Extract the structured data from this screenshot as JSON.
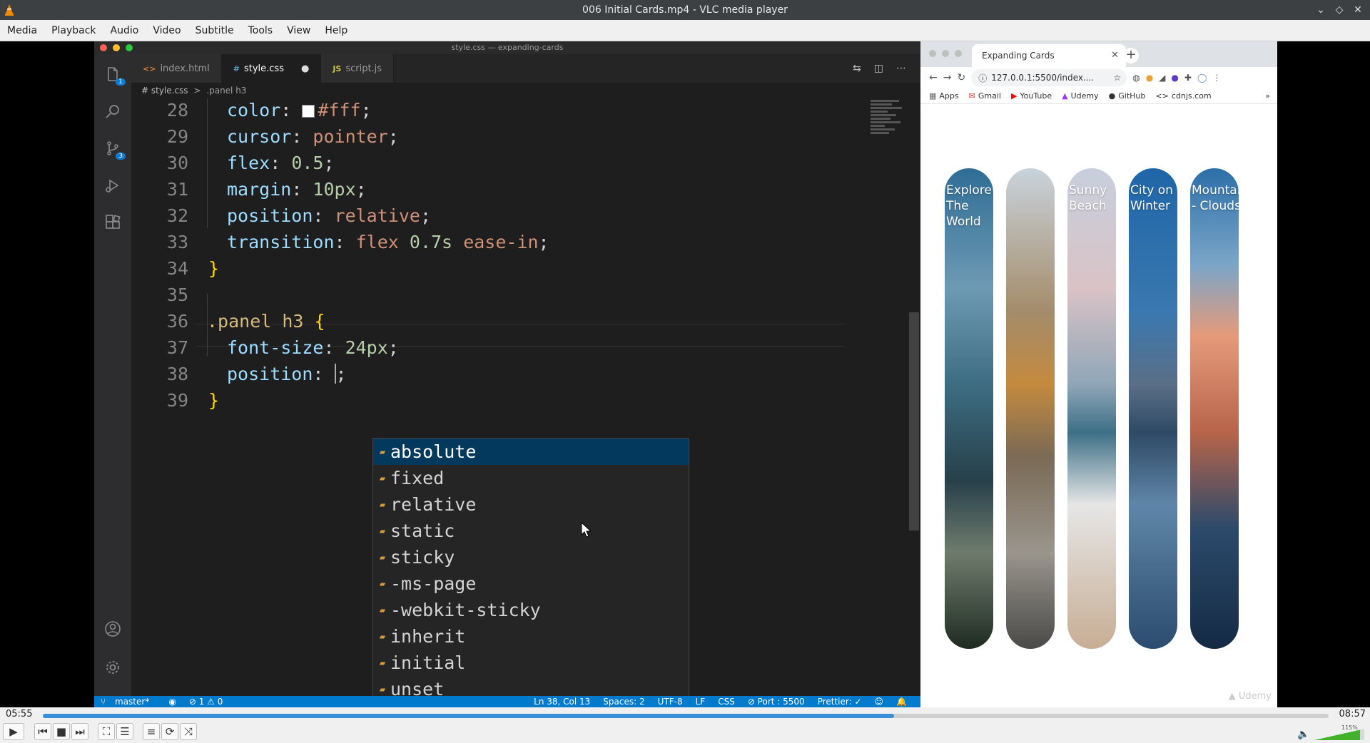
{
  "window": {
    "title": "006 Initial Cards.mp4 - VLC media player"
  },
  "menu": [
    "Media",
    "Playback",
    "Audio",
    "Video",
    "Subtitle",
    "Tools",
    "View",
    "Help"
  ],
  "vscode": {
    "title": "style.css — expanding-cards",
    "tabs": [
      {
        "icon": "<>",
        "label": "index.html"
      },
      {
        "icon": "#",
        "label": "style.css",
        "dirty": "●"
      },
      {
        "icon": "JS",
        "label": "script.js"
      }
    ],
    "activity_badges": [
      "1",
      "3"
    ],
    "breadcrumb": {
      "file": "# style.css",
      "sep": ">",
      "symbol": ".panel h3"
    },
    "line_numbers": [
      "28",
      "29",
      "30",
      "31",
      "32",
      "33",
      "34",
      "35",
      "36",
      "37",
      "38",
      "39"
    ],
    "code": {
      "l28": {
        "prop": "color",
        "val": "#fff"
      },
      "l29": {
        "prop": "cursor",
        "val": "pointer"
      },
      "l30": {
        "prop": "flex",
        "val": "0.5"
      },
      "l31": {
        "prop": "margin",
        "val": "10px"
      },
      "l32": {
        "prop": "position",
        "val": "relative"
      },
      "l33": {
        "prop": "transition",
        "val1": "flex",
        "val2": "0.7s",
        "val3": "ease-in"
      },
      "l34": "}",
      "l36": {
        "selector": ".panel h3",
        "brace": "{"
      },
      "l37": {
        "prop": "font-size",
        "val": "24px"
      },
      "l38": {
        "prop": "position"
      },
      "l39": "}"
    },
    "suggestions": [
      "absolute",
      "fixed",
      "relative",
      "static",
      "sticky",
      "-ms-page",
      "-webkit-sticky",
      "inherit",
      "initial",
      "unset"
    ],
    "status": {
      "branch": "master*",
      "problems": "⊘ 1 ⚠ 0",
      "position": "Ln 38, Col 13",
      "spaces": "Spaces: 2",
      "encoding": "UTF-8",
      "eol": "LF",
      "language": "CSS",
      "port": "⊘ Port : 5500",
      "prettier": "Prettier: ✓"
    }
  },
  "browser": {
    "tab_title": "Expanding Cards",
    "url": "127.0.0.1:5500/index....",
    "bookmarks": [
      "Apps",
      "Gmail",
      "YouTube",
      "Udemy",
      "GitHub",
      "cdnjs.com"
    ],
    "cards": [
      "Explore The World",
      "",
      "Sunny Beach",
      "City on Winter",
      "Mountains - Clouds"
    ],
    "watermark": "Udemy"
  },
  "player": {
    "elapsed": "05:55",
    "total": "08:57",
    "progress": 0.662,
    "volume_label": "115%"
  }
}
